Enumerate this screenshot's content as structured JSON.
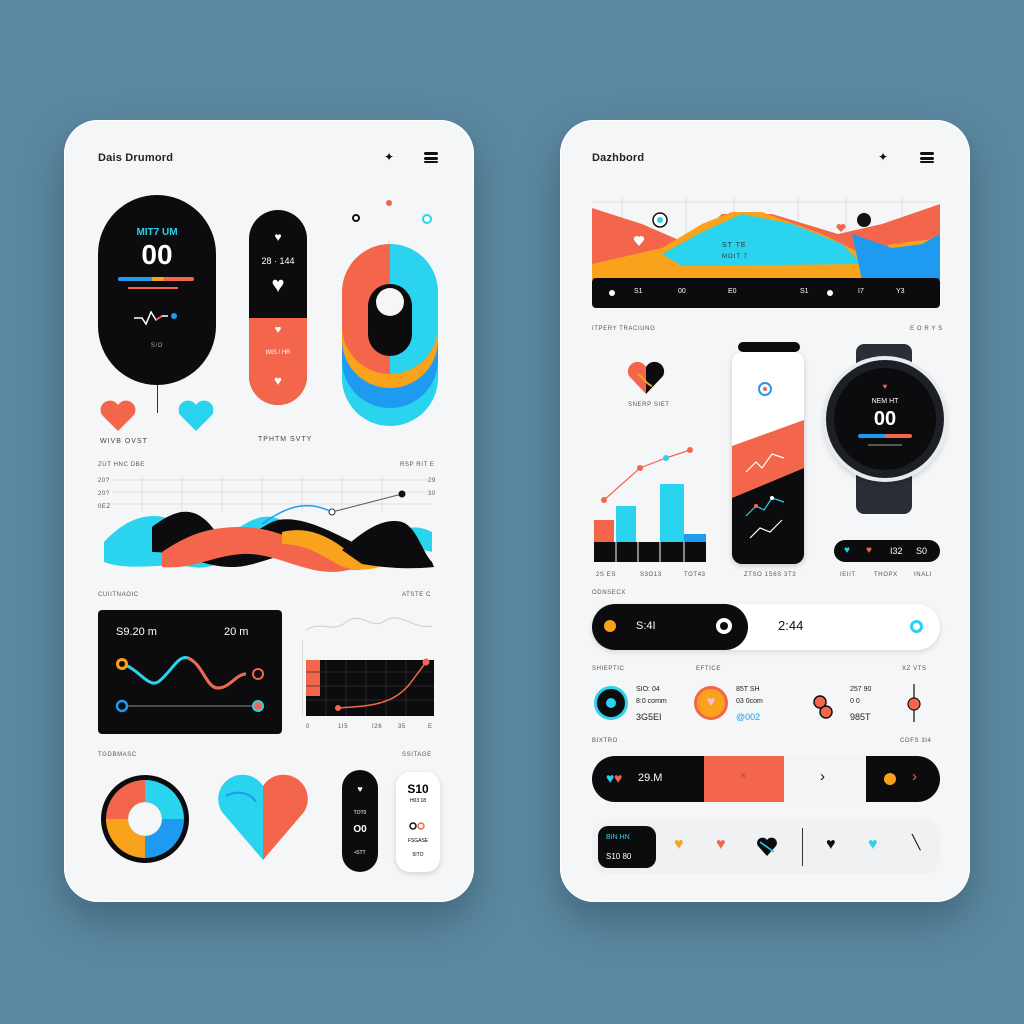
{
  "left": {
    "title": "Dais Drumord",
    "watch": {
      "label": "MIT7 UM",
      "value": "00",
      "sub": "S/O"
    },
    "band": {
      "top": "28 · 144",
      "mid": "WIS / HR"
    },
    "heart_caption": "WIVB OVST",
    "band_caption": "TPHTM SVTY",
    "wave_section": {
      "title": "ZUT HNC DBE",
      "right": "RSP RIT E",
      "ticks_left": [
        "20?",
        "20?",
        "0EZ"
      ],
      "ticks_right": [
        "29",
        "30"
      ]
    },
    "activity": {
      "title": "CUIITNAOIC",
      "right": "ATSTE C",
      "readout_left": "S9.20 m",
      "readout_right": "20 m"
    },
    "bar_ticks": [
      "0",
      "1I5",
      "I26",
      "35",
      "E"
    ],
    "bottom": {
      "title": "TGDBMASC",
      "right": "SSITAGE",
      "card1_top": "S10",
      "card1_sub": "H03 18",
      "card1_foot": "FSGASE",
      "card1_foot2": "5ITO",
      "strip_lines": [
        "TOT0",
        "O0",
        "•STT"
      ]
    }
  },
  "right": {
    "title": "Dazhbord",
    "area_chart": {
      "center_top": "ST TE",
      "center_sub": "MOIT 7",
      "axis": [
        "S1",
        "00",
        "E0",
        "S1",
        "I7",
        "Y3"
      ]
    },
    "section": {
      "title": "ITPERY TRACIUNG",
      "right": "E O R Y S"
    },
    "heart_caption": "SNERP SIET",
    "bar_ticks": [
      "2S ES",
      "S3O13",
      "TOT43"
    ],
    "band_caption": "ZTSO 1S6S 3T3",
    "watch": {
      "label": "NEM HT",
      "value": "00"
    },
    "watch_strip": {
      "v1": "I32",
      "v2": "S0"
    },
    "watch_captions": [
      "IEIIT",
      "THOPX",
      "INALI"
    ],
    "progress": {
      "title": "ODNSECX",
      "chip": "S:4I",
      "time": "2:44"
    },
    "stats": {
      "title": "SHIEPTIC",
      "mid": "EFTICE",
      "right": "XZ VTS",
      "col1": [
        "SIO: 04",
        "8:0  comm",
        "3G5EI"
      ],
      "col2": [
        "85T SH",
        "03 0com",
        "@002"
      ],
      "col3": [
        "257 90",
        "0 0",
        "985T"
      ]
    },
    "bar1": {
      "title": "BIXTRO",
      "right": "COFS 3I4",
      "value": "29.M"
    },
    "bar2": {
      "l1": "BIN HN",
      "l2": "S10 80"
    }
  },
  "colors": {
    "orange": "#f4664b",
    "cyan": "#2ad3ee",
    "blue": "#1e9bf0",
    "yellow": "#f9a21b",
    "black": "#0c0c0e",
    "bg": "#5b88a0"
  }
}
